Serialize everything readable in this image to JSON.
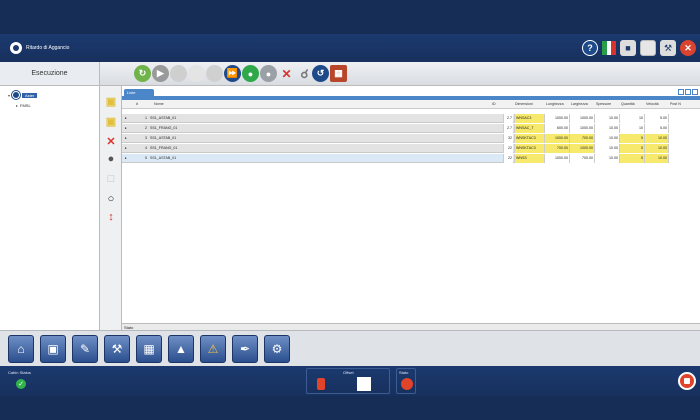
{
  "app": {
    "title": "Ritardo di Aggancio"
  },
  "left_panel": {
    "title": "Esecuzione",
    "tree": [
      {
        "label": "Aster",
        "selected": true
      },
      {
        "label": "FMSL",
        "selected": false
      }
    ]
  },
  "grid": {
    "tab_label": "Liste",
    "columns": [
      "#",
      "Nome",
      "ID",
      "Dimensioni",
      "Lunghezza",
      "Larghezza",
      "Spessore",
      "Quantità",
      "Velocità",
      "Post N"
    ],
    "rows": [
      {
        "num": "1",
        "name": "SS1_ASTAB_01",
        "id": "2.7",
        "dim": "WNSAC3",
        "lung": "1000.00",
        "larg": "1000.00",
        "spess": "10.00",
        "qty": "10",
        "vel": "5.00",
        "highlight": ""
      },
      {
        "num": "2",
        "name": "SS1_FRANG_01",
        "id": "2.7",
        "dim": "WNSAC_T",
        "lung": "600.00",
        "larg": "1000.00",
        "spess": "10.00",
        "qty": "10",
        "vel": "5.00",
        "highlight": ""
      },
      {
        "num": "3",
        "name": "SS1_ASTAB_01",
        "id": "32",
        "dim": "WNSKTAC3",
        "lung": "1000.00",
        "larg": "700.00",
        "spess": "10.00",
        "qty": "5",
        "vel": "10.00",
        "highlight": "y"
      },
      {
        "num": "4",
        "name": "SS1_FRANG_01",
        "id": "22",
        "dim": "WNSKTAC3",
        "lung": "700.00",
        "larg": "1000.00",
        "spess": "10.00",
        "qty": "5",
        "vel": "10.00",
        "highlight": "y"
      },
      {
        "num": "5",
        "name": "SS1_ASTAB_01",
        "id": "22",
        "dim": "WNSS",
        "lung": "1000.00",
        "larg": "700.00",
        "spess": "10.00",
        "qty": "5",
        "vel": "10.00",
        "highlight": "y"
      }
    ],
    "footer_label": "Stato"
  },
  "statusbar": {
    "left_label": "Cabin Status",
    "mid_label": "Offset",
    "right_label": "Stato"
  }
}
